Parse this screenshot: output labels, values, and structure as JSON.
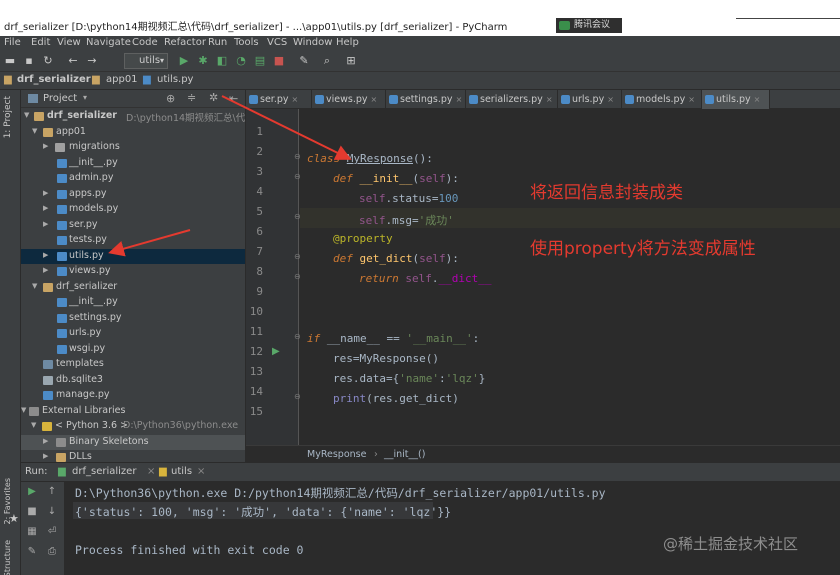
{
  "window": {
    "title": "drf_serializer [D:\\python14期视频汇总\\代码\\drf_serializer] - ...\\app01\\utils.py [drf_serializer] - PyCharm",
    "meeting_badge": "腾讯会议"
  },
  "menu": [
    "File",
    "Edit",
    "View",
    "Navigate",
    "Code",
    "Refactor",
    "Run",
    "Tools",
    "VCS",
    "Window",
    "Help"
  ],
  "toolbar": {
    "run_config": "utils"
  },
  "navbar": {
    "crumbs": [
      "drf_serializer",
      "app01",
      "utils.py"
    ]
  },
  "sidebar": {
    "label": "1: Project"
  },
  "project_panel": {
    "header": "Project",
    "root_name": "drf_serializer",
    "root_path": "D:\\python14期视频汇总\\代码\\drf_se",
    "items": [
      {
        "label": "app01"
      },
      {
        "label": "migrations"
      },
      {
        "label": "__init__.py"
      },
      {
        "label": "admin.py"
      },
      {
        "label": "apps.py"
      },
      {
        "label": "models.py"
      },
      {
        "label": "ser.py"
      },
      {
        "label": "tests.py"
      },
      {
        "label": "utils.py"
      },
      {
        "label": "views.py"
      },
      {
        "label": "drf_serializer"
      },
      {
        "label": "__init__.py"
      },
      {
        "label": "settings.py"
      },
      {
        "label": "urls.py"
      },
      {
        "label": "wsgi.py"
      },
      {
        "label": "templates"
      },
      {
        "label": "db.sqlite3"
      },
      {
        "label": "manage.py"
      },
      {
        "label": "External Libraries"
      },
      {
        "label": "< Python 3.6 >",
        "path": "D:\\Python36\\python.exe"
      },
      {
        "label": "Binary Skeletons"
      },
      {
        "label": "DLLs"
      }
    ]
  },
  "editor_tabs": [
    {
      "label": "ser.py"
    },
    {
      "label": "views.py"
    },
    {
      "label": "settings.py"
    },
    {
      "label": "serializers.py"
    },
    {
      "label": "urls.py"
    },
    {
      "label": "models.py"
    },
    {
      "label": "utils.py"
    }
  ],
  "editor": {
    "line_numbers": [
      "1",
      "2",
      "3",
      "4",
      "5",
      "6",
      "7",
      "8",
      "9",
      "10",
      "11",
      "12",
      "13",
      "14",
      "15"
    ],
    "breadcrumb": [
      "MyResponse",
      "__init__()"
    ]
  },
  "annotations": {
    "note1": "将返回信息封装成类",
    "note2": "使用property将方法变成属性",
    "color": "#e43a2f"
  },
  "run_panel": {
    "label": "Run:",
    "tabs": [
      "drf_serializer",
      "utils"
    ],
    "console_lines": [
      "D:\\Python36\\python.exe D:/python14期视频汇总/代码/drf_serializer/app01/utils.py",
      "{'status': 100, 'msg': '成功', 'data': {'name': 'lqz'}}",
      "Process finished with exit code 0"
    ],
    "side_labels": [
      "2: Favorites",
      "Structure"
    ]
  },
  "watermark": "@稀土掘金技术社区"
}
